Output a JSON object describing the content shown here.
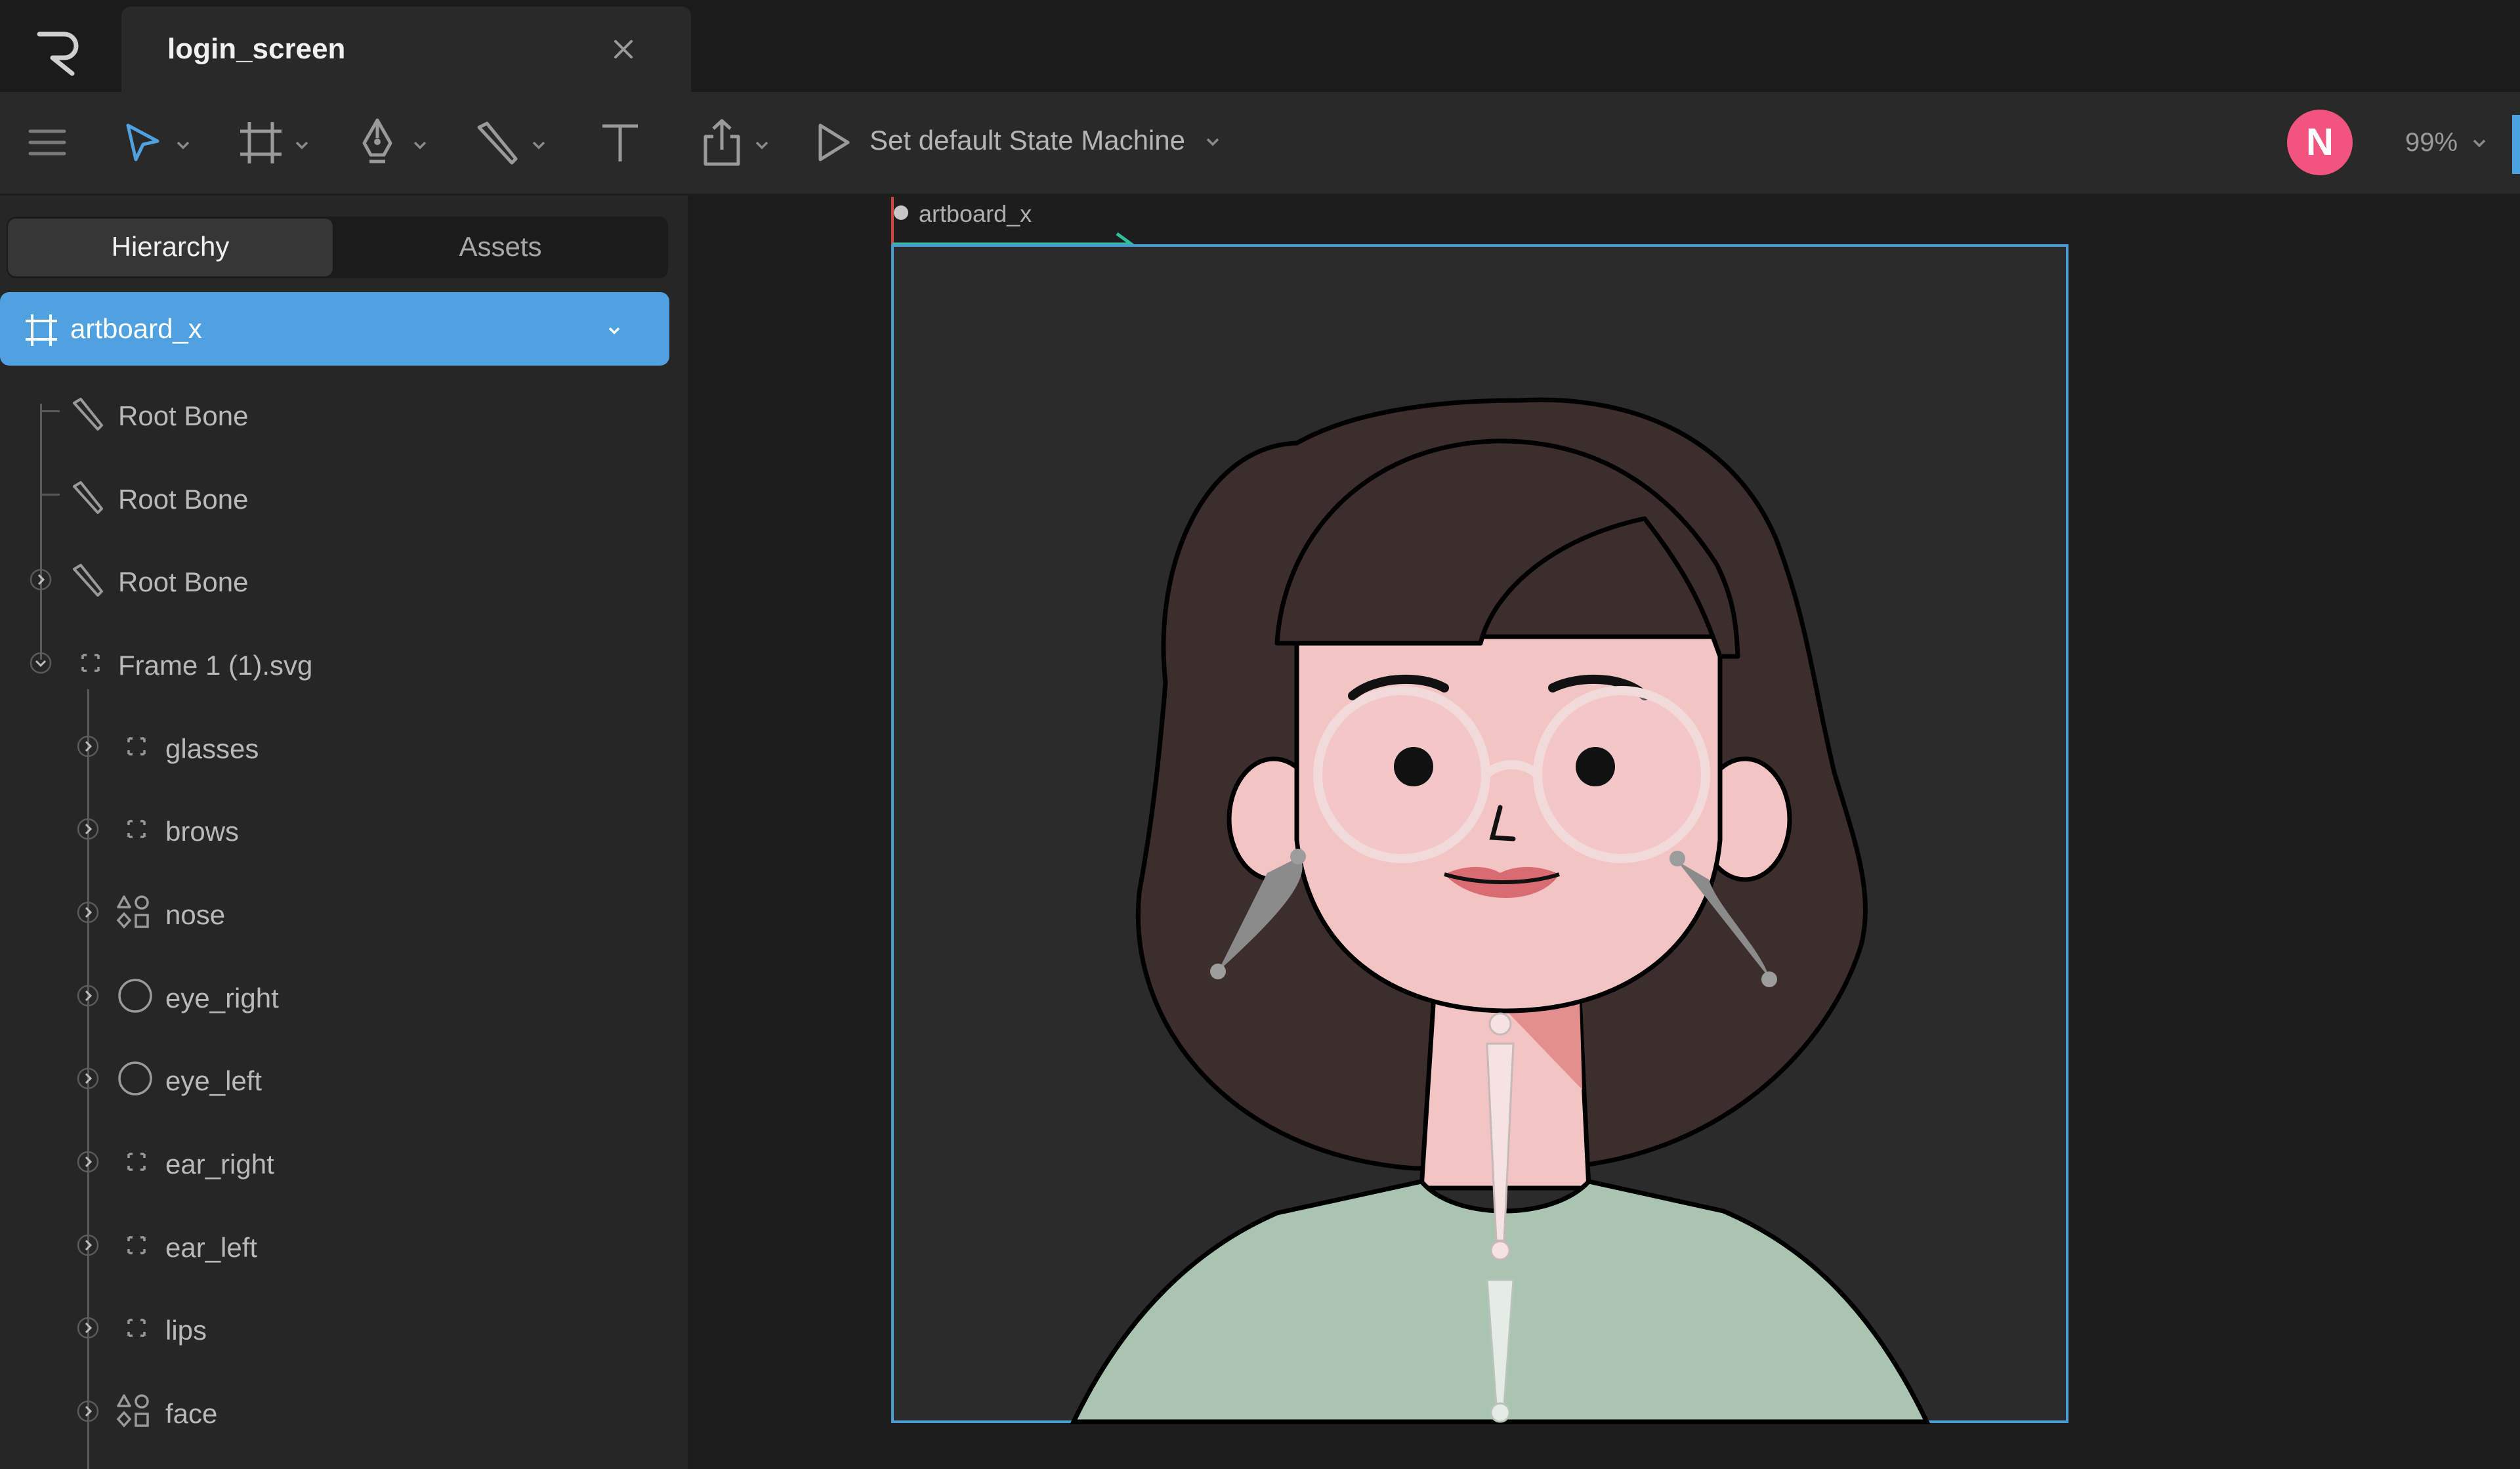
{
  "window": {
    "tab_title": "login_screen"
  },
  "toolbar": {
    "tools": [
      "menu-icon",
      "select-tool-icon",
      "artboard-tool-icon",
      "pen-tool-icon",
      "bone-tool-icon",
      "text-tool-icon",
      "export-icon",
      "play-icon"
    ],
    "state_machine_label": "Set default State Machine",
    "user_initial": "N",
    "zoom": "99%"
  },
  "panel": {
    "tabs": [
      "Hierarchy",
      "Assets"
    ],
    "active_tab": "Hierarchy",
    "artboard": "artboard_x",
    "items": [
      {
        "label": "Root Bone",
        "icon": "bone-icon"
      },
      {
        "label": "Root Bone",
        "icon": "bone-icon"
      },
      {
        "label": "Root Bone",
        "icon": "bone-icon"
      },
      {
        "label": "Frame 1 (1).svg",
        "icon": "group-icon"
      },
      {
        "label": "glasses",
        "icon": "group-icon"
      },
      {
        "label": "brows",
        "icon": "group-icon"
      },
      {
        "label": "nose",
        "icon": "shapes-icon"
      },
      {
        "label": "eye_right",
        "icon": "ellipse-icon"
      },
      {
        "label": "eye_left",
        "icon": "ellipse-icon"
      },
      {
        "label": "ear_right",
        "icon": "group-icon"
      },
      {
        "label": "ear_left",
        "icon": "group-icon"
      },
      {
        "label": "lips",
        "icon": "group-icon"
      },
      {
        "label": "face",
        "icon": "shapes-icon"
      }
    ]
  },
  "canvas": {
    "artboard_label": "artboard_x"
  },
  "colors": {
    "accent": "#4fa1e0",
    "avatar": "#f2547f",
    "artboard_bg": "#2b2b2b",
    "hair": "#3b2e2c",
    "skin": "#f2c4c4",
    "shirt": "#a9c4b1"
  }
}
